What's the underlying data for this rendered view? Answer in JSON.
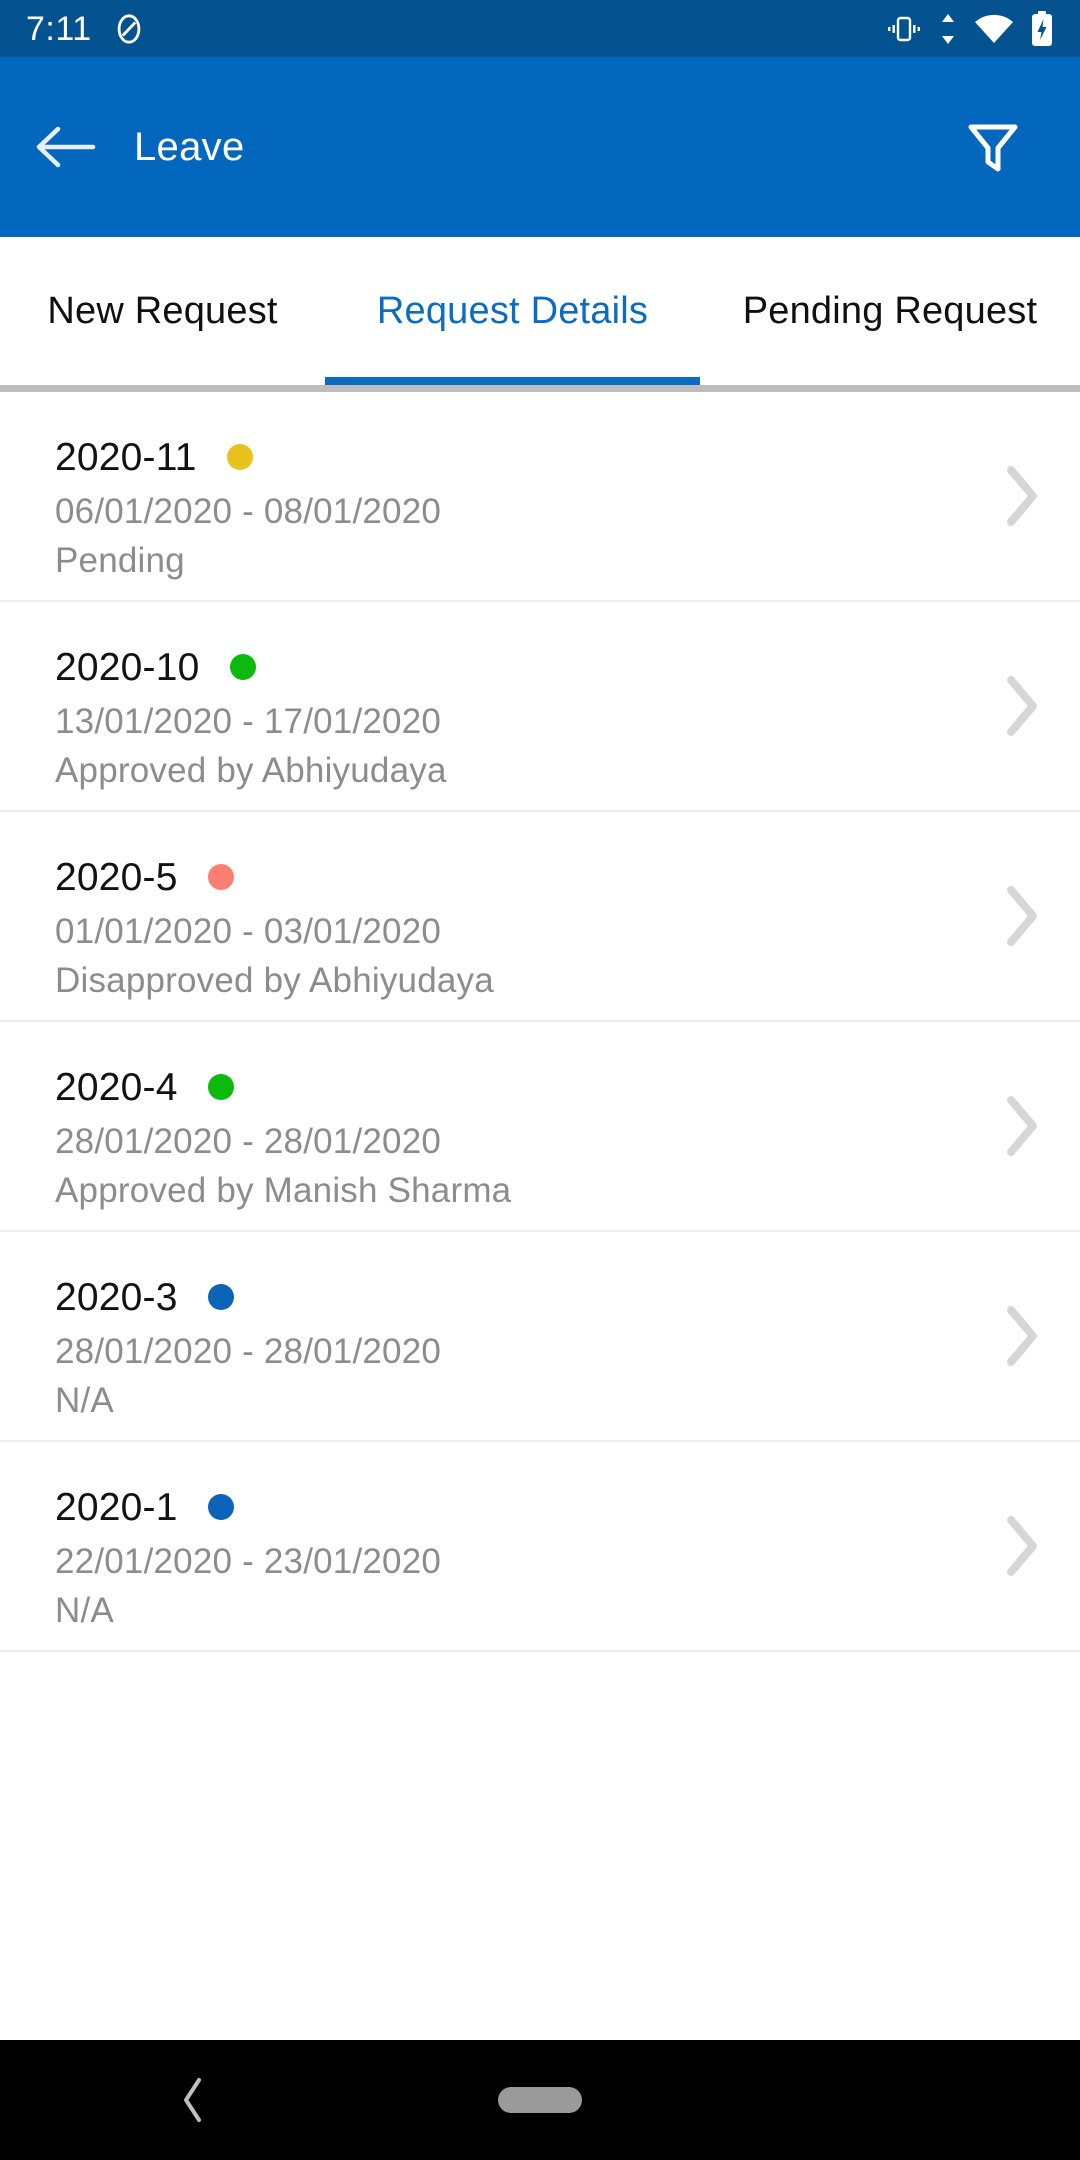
{
  "status_bar": {
    "time": "7:11",
    "icons": {
      "notification": "do-not-disturb-icon",
      "vibrate": "vibrate-icon",
      "data_transfer": "data-transfer-arrows-icon",
      "wifi": "wifi-icon",
      "battery": "battery-charging-icon"
    }
  },
  "app_bar": {
    "back_icon": "back-arrow-icon",
    "title": "Leave",
    "filter_icon": "filter-funnel-icon"
  },
  "tabs": [
    {
      "label": "New Request",
      "active": false
    },
    {
      "label": "Request Details",
      "active": true
    },
    {
      "label": "Pending Request",
      "active": false
    }
  ],
  "colors": {
    "status_bar_bg": "#04528F",
    "app_bar_bg": "#0367BD",
    "accent": "#0C6CC2",
    "pending": "#E8C31E",
    "approved": "#0CB90C",
    "disapproved": "#FA7F72",
    "na": "#0C64B8",
    "secondary_text": "#8C8C8C",
    "divider": "#ECECEC"
  },
  "requests": [
    {
      "id": "2020-11",
      "dot_color": "#E8C31E",
      "dot_status": "pending",
      "dates": "06/01/2020 - 08/01/2020",
      "status": "Pending"
    },
    {
      "id": "2020-10",
      "dot_color": "#0CB90C",
      "dot_status": "approved",
      "dates": "13/01/2020 - 17/01/2020",
      "status": "Approved by Abhiyudaya"
    },
    {
      "id": "2020-5",
      "dot_color": "#FA7F72",
      "dot_status": "disapproved",
      "dates": "01/01/2020 - 03/01/2020",
      "status": "Disapproved by Abhiyudaya"
    },
    {
      "id": "2020-4",
      "dot_color": "#0CB90C",
      "dot_status": "approved",
      "dates": "28/01/2020 - 28/01/2020",
      "status": "Approved by Manish Sharma"
    },
    {
      "id": "2020-3",
      "dot_color": "#0C64B8",
      "dot_status": "na",
      "dates": "28/01/2020 - 28/01/2020",
      "status": "N/A"
    },
    {
      "id": "2020-1",
      "dot_color": "#0C64B8",
      "dot_status": "na",
      "dates": "22/01/2020 - 23/01/2020",
      "status": "N/A"
    }
  ],
  "nav_bar": {
    "back_icon": "nav-back-chevron-icon",
    "home_indicator": "home-pill-indicator"
  }
}
